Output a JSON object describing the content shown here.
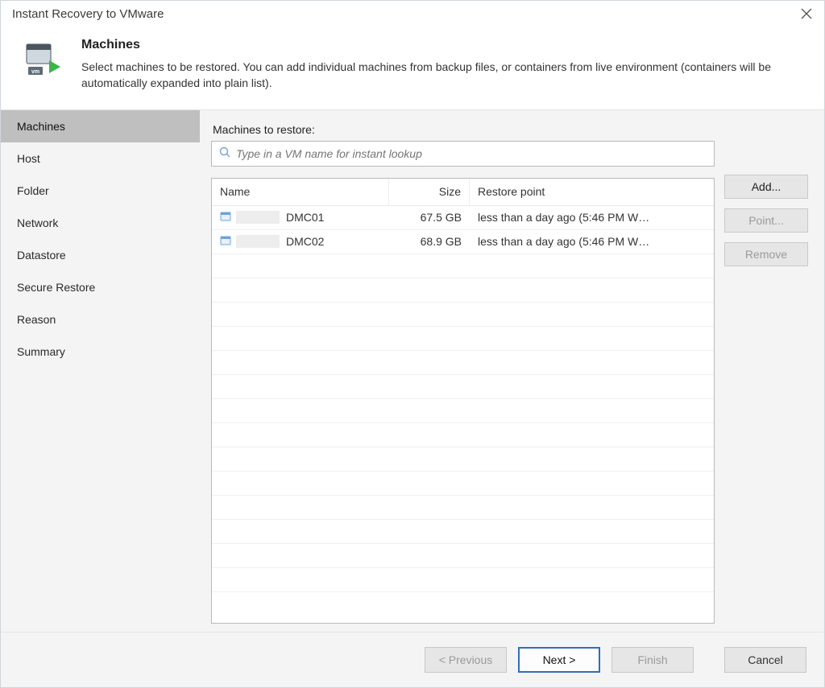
{
  "window": {
    "title": "Instant Recovery to VMware"
  },
  "header": {
    "heading": "Machines",
    "description": "Select machines to be restored. You can add individual machines from backup files, or containers from live environment (containers will be automatically expanded into plain list)."
  },
  "sidebar": {
    "steps": [
      {
        "label": "Machines",
        "active": true
      },
      {
        "label": "Host",
        "active": false
      },
      {
        "label": "Folder",
        "active": false
      },
      {
        "label": "Network",
        "active": false
      },
      {
        "label": "Datastore",
        "active": false
      },
      {
        "label": "Secure Restore",
        "active": false
      },
      {
        "label": "Reason",
        "active": false
      },
      {
        "label": "Summary",
        "active": false
      }
    ]
  },
  "main": {
    "section_label": "Machines to restore:",
    "search_placeholder": "Type in a VM name for instant lookup",
    "columns": {
      "name": "Name",
      "size": "Size",
      "restore_point": "Restore point"
    },
    "rows": [
      {
        "name": "DMC01",
        "size": "67.5 GB",
        "restore_point": "less than a day ago (5:46 PM W…"
      },
      {
        "name": "DMC02",
        "size": "68.9 GB",
        "restore_point": "less than a day ago (5:46 PM W…"
      }
    ],
    "buttons": {
      "add": "Add...",
      "point": "Point...",
      "remove": "Remove"
    }
  },
  "footer": {
    "previous": "< Previous",
    "next": "Next >",
    "finish": "Finish",
    "cancel": "Cancel"
  }
}
